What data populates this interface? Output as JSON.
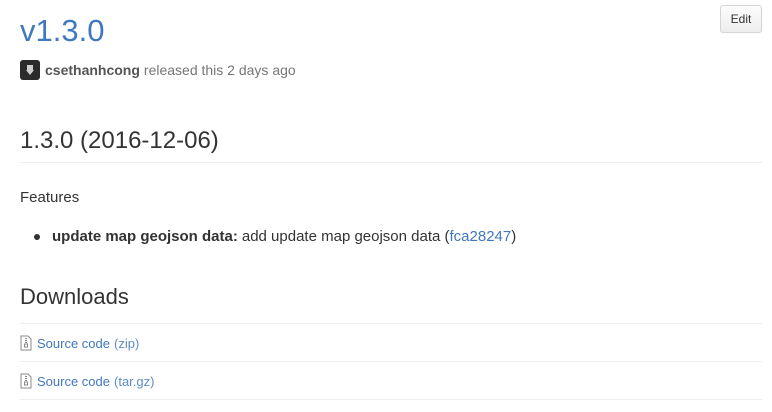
{
  "release": {
    "title": "v1.3.0",
    "author": "csethanhcong",
    "meta_text": "released this 2 days ago",
    "edit_label": "Edit"
  },
  "notes": {
    "version_heading": "1.3.0 (2016-12-06)",
    "section_label": "Features",
    "features": [
      {
        "title": "update map geojson data:",
        "text": " add update map geojson data (",
        "commit": "fca28247",
        "suffix": ")"
      }
    ]
  },
  "downloads": {
    "heading": "Downloads",
    "items": [
      {
        "label": "Source code",
        "ext": "(zip)"
      },
      {
        "label": "Source code",
        "ext": "(tar.gz)"
      }
    ]
  },
  "colors": {
    "link": "#4078c0",
    "text": "#333333",
    "muted": "#767676",
    "divider": "#eeeeee"
  },
  "icons": {
    "avatar": "avatar-icon",
    "file": "file-zip-icon"
  }
}
